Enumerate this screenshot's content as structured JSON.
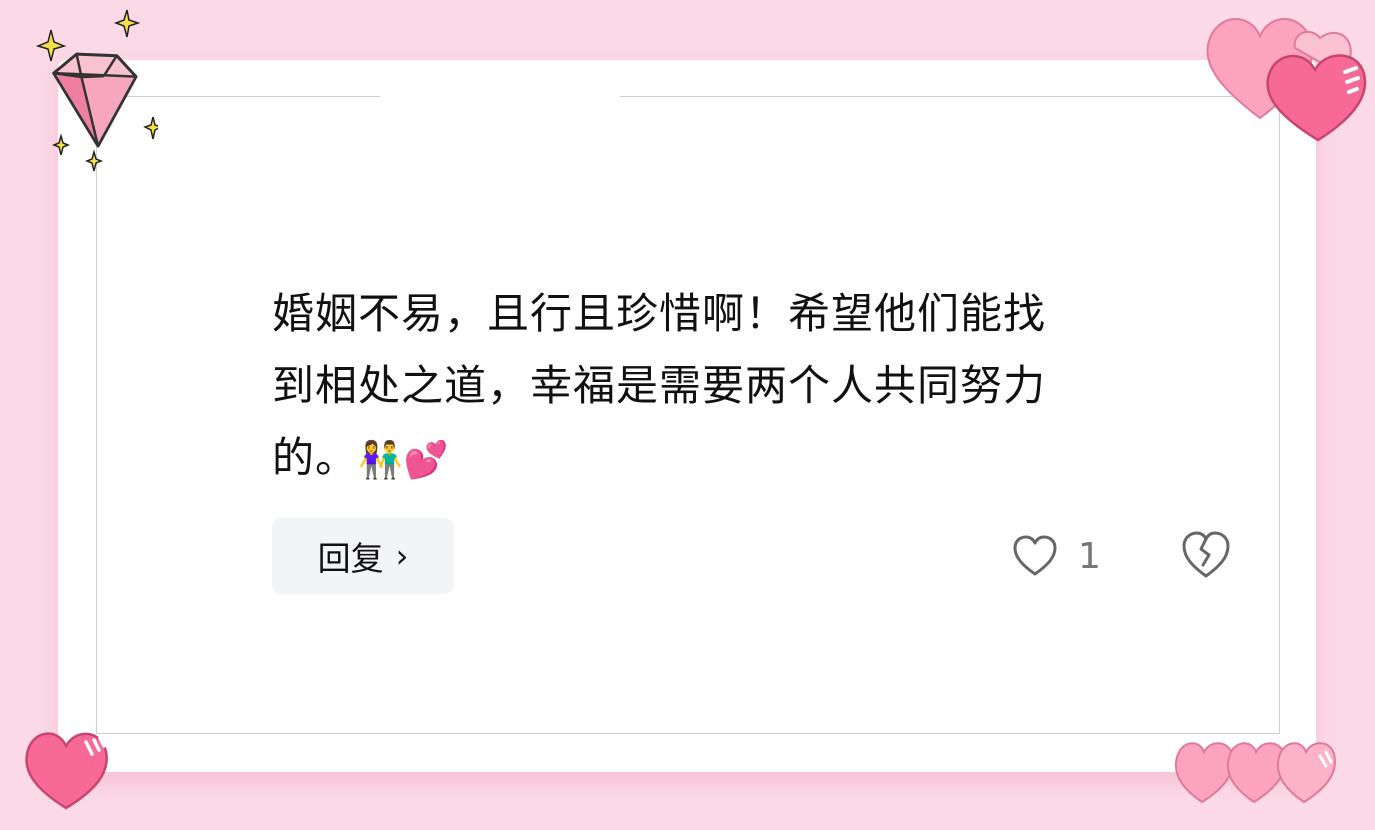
{
  "comment": {
    "text_line1": "婚姻不易，且行且珍惜啊！希望他们能找",
    "text_line2": "到相处之道，幸福是需要两个人共同努力",
    "text_line3": "的。",
    "emoji_couple": "👫",
    "emoji_hearts": "💕"
  },
  "actions": {
    "reply_label": "回复",
    "reply_chevron": "›",
    "like_count": "1"
  },
  "icons": {
    "like": "heart-outline-icon",
    "dislike": "broken-heart-icon",
    "decor_top_left": "diamond-gem-icon",
    "decor_top_right": "hearts-icon",
    "decor_bottom_left": "heart-icon",
    "decor_bottom_right": "hearts-icon"
  },
  "colors": {
    "background": "#fbd9e6",
    "heart_pink": "#f76a97",
    "heart_light": "#fca3c0",
    "button_bg": "#f3f4f6"
  }
}
